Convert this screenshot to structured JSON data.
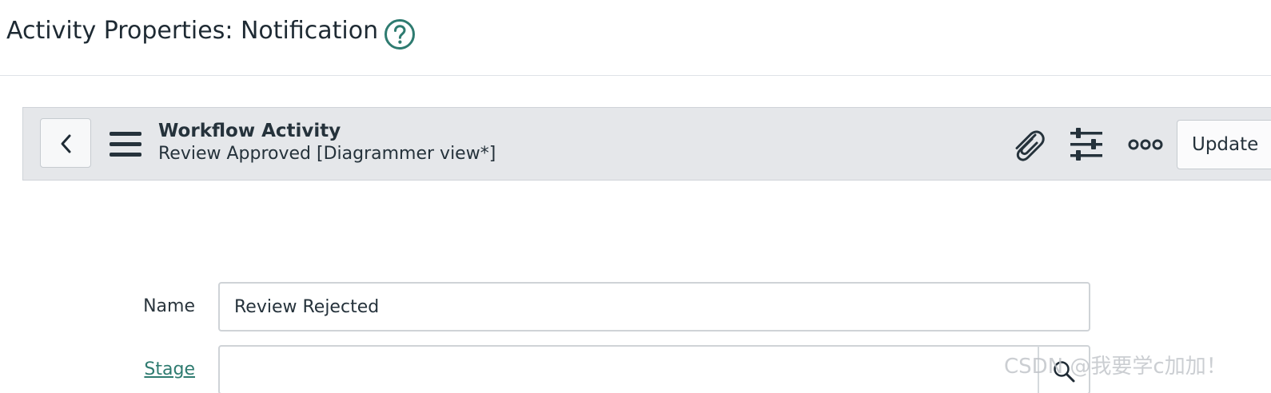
{
  "header": {
    "title": "Activity Properties: Notification",
    "help_icon": "question-circle-icon"
  },
  "toolbar": {
    "back_icon": "chevron-left-icon",
    "menu_icon": "hamburger-menu-icon",
    "record_type": "Workflow Activity",
    "record_name": "Review Approved [Diagrammer view*]",
    "attachment_icon": "paperclip-icon",
    "personalize_icon": "sliders-icon",
    "more_icon": "more-options-icon",
    "update_label": "Update"
  },
  "form": {
    "name": {
      "label": "Name",
      "value": "Review Rejected"
    },
    "stage": {
      "label": "Stage",
      "value": "",
      "lookup_icon": "search-icon"
    }
  },
  "watermark": "CSDN @我要学c加加！",
  "colors": {
    "accent": "#2e7b70",
    "toolbar_bg": "#e5e7ea",
    "text": "#25323b"
  }
}
